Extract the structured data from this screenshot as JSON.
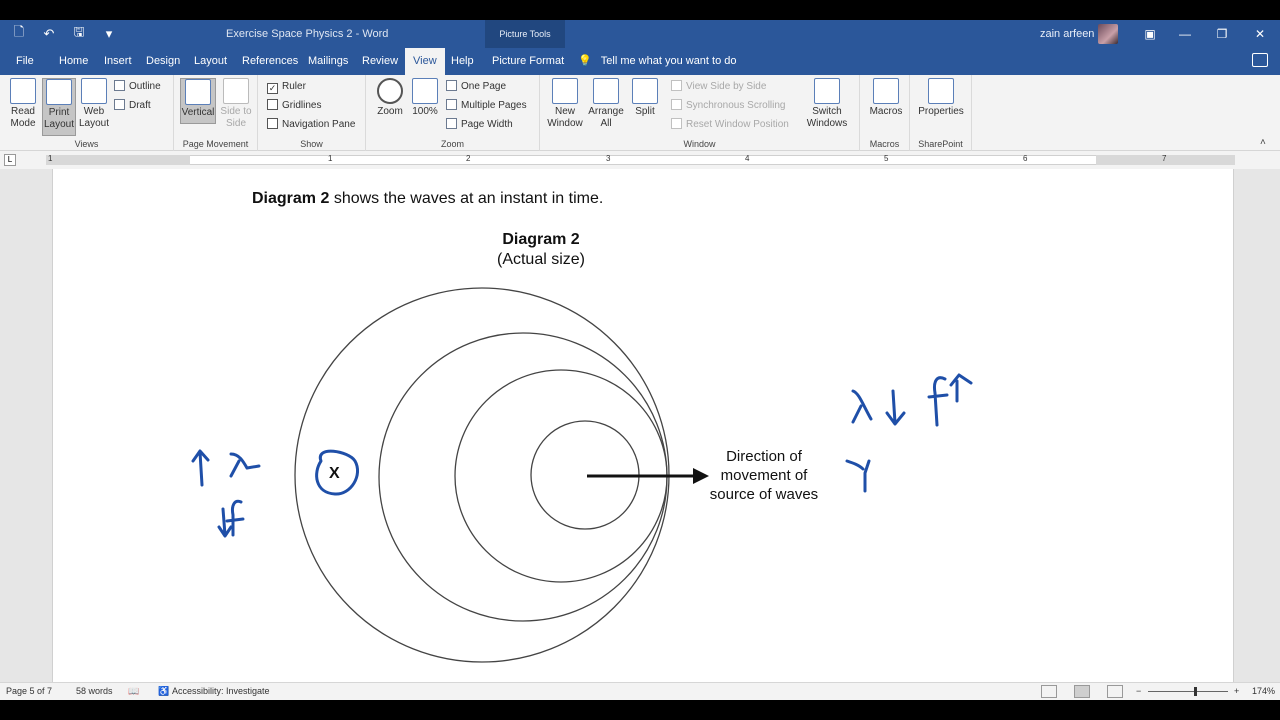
{
  "window": {
    "title": "Exercise Space Physics 2  -  Word",
    "context_tab": "Picture Tools",
    "user": "zain arfeen",
    "minimize_glyph": "—",
    "restore_glyph": "❐",
    "close_glyph": "✕"
  },
  "qat": {
    "new_icon": "new-document-icon",
    "undo_icon": "undo-icon",
    "save_icon": "save-icon",
    "customize_icon": "customize-icon"
  },
  "tabs": {
    "file": "File",
    "home": "Home",
    "insert": "Insert",
    "design": "Design",
    "layout": "Layout",
    "references": "References",
    "mailings": "Mailings",
    "review": "Review",
    "view": "View",
    "help": "Help",
    "picture_format": "Picture Format",
    "tell_me": "Tell me what you want to do"
  },
  "ribbon": {
    "views": {
      "label": "Views",
      "read_mode": "Read Mode",
      "print_layout": "Print Layout",
      "web_layout": "Web Layout",
      "outline": "Outline",
      "draft": "Draft"
    },
    "page_movement": {
      "label": "Page Movement",
      "vertical": "Vertical",
      "side_to_side": "Side to Side"
    },
    "show": {
      "label": "Show",
      "ruler": "Ruler",
      "gridlines": "Gridlines",
      "navigation_pane": "Navigation Pane",
      "ruler_checked": "✓"
    },
    "zoom": {
      "label": "Zoom",
      "zoom": "Zoom",
      "hundred": "100%",
      "one_page": "One Page",
      "multiple_pages": "Multiple Pages",
      "page_width": "Page Width"
    },
    "window": {
      "label": "Window",
      "new_window": "New Window",
      "arrange_all": "Arrange All",
      "split": "Split",
      "view_side_by_side": "View Side by Side",
      "sync_scrolling": "Synchronous Scrolling",
      "reset_window": "Reset Window Position",
      "switch_windows": "Switch Windows"
    },
    "macros": {
      "label": "Macros",
      "macros": "Macros"
    },
    "sharepoint": {
      "label": "SharePoint",
      "properties": "Properties"
    }
  },
  "ruler": {
    "numbers": [
      "1",
      "1",
      "2",
      "3",
      "4",
      "5",
      "6",
      "7"
    ],
    "tab_selector": "L"
  },
  "document": {
    "intro_bold": "Diagram 2",
    "intro_rest": " shows the waves at an instant in time.",
    "diagram_title": "Diagram 2",
    "diagram_subtitle": "(Actual size)",
    "direction_line1": "Direction of",
    "direction_line2": "movement of",
    "direction_line3": "source of waves",
    "point_label": "X"
  },
  "status": {
    "page": "Page 5 of 7",
    "words": "58 words",
    "accessibility": "Accessibility: Investigate",
    "zoom_level": "174%",
    "zoom_minus": "−",
    "zoom_plus": "+"
  }
}
